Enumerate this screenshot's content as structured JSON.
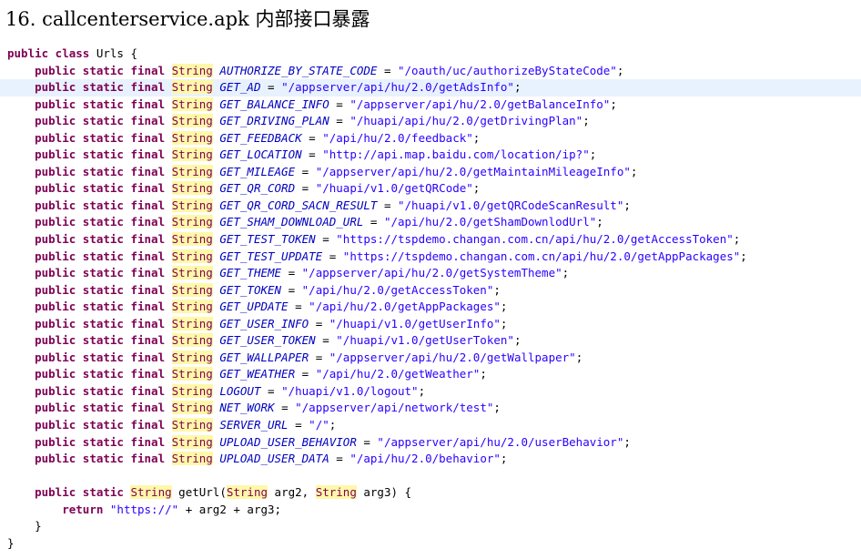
{
  "heading": "16. callcenterservice.apk 内部接口暴露",
  "code": {
    "class_header": {
      "keywords": "public class",
      "name": "Urls",
      "brace": "{"
    },
    "modifiers": "public static final",
    "type_name": "String",
    "fields": [
      {
        "name": "AUTHORIZE_BY_STATE_CODE",
        "value": "\"/oauth/uc/authorizeByStateCode\""
      },
      {
        "name": "GET_AD",
        "value": "\"/appserver/api/hu/2.0/getAdsInfo\""
      },
      {
        "name": "GET_BALANCE_INFO",
        "value": "\"/appserver/api/hu/2.0/getBalanceInfo\""
      },
      {
        "name": "GET_DRIVING_PLAN",
        "value": "\"/huapi/api/hu/2.0/getDrivingPlan\""
      },
      {
        "name": "GET_FEEDBACK",
        "value": "\"/api/hu/2.0/feedback\""
      },
      {
        "name": "GET_LOCATION",
        "value": "\"http://api.map.baidu.com/location/ip?\""
      },
      {
        "name": "GET_MILEAGE",
        "value": "\"/appserver/api/hu/2.0/getMaintainMileageInfo\""
      },
      {
        "name": "GET_QR_CORD",
        "value": "\"/huapi/v1.0/getQRCode\""
      },
      {
        "name": "GET_QR_CORD_SACN_RESULT",
        "value": "\"/huapi/v1.0/getQRCodeScanResult\""
      },
      {
        "name": "GET_SHAM_DOWNLOAD_URL",
        "value": "\"/api/hu/2.0/getShamDownlodUrl\""
      },
      {
        "name": "GET_TEST_TOKEN",
        "value": "\"https://tspdemo.changan.com.cn/api/hu/2.0/getAccessToken\""
      },
      {
        "name": "GET_TEST_UPDATE",
        "value": "\"https://tspdemo.changan.com.cn/api/hu/2.0/getAppPackages\""
      },
      {
        "name": "GET_THEME",
        "value": "\"/appserver/api/hu/2.0/getSystemTheme\""
      },
      {
        "name": "GET_TOKEN",
        "value": "\"/api/hu/2.0/getAccessToken\""
      },
      {
        "name": "GET_UPDATE",
        "value": "\"/api/hu/2.0/getAppPackages\""
      },
      {
        "name": "GET_USER_INFO",
        "value": "\"/huapi/v1.0/getUserInfo\""
      },
      {
        "name": "GET_USER_TOKEN",
        "value": "\"/huapi/v1.0/getUserToken\""
      },
      {
        "name": "GET_WALLPAPER",
        "value": "\"/appserver/api/hu/2.0/getWallpaper\""
      },
      {
        "name": "GET_WEATHER",
        "value": "\"/api/hu/2.0/getWeather\""
      },
      {
        "name": "LOGOUT",
        "value": "\"/huapi/v1.0/logout\""
      },
      {
        "name": "NET_WORK",
        "value": "\"/appserver/api/network/test\""
      },
      {
        "name": "SERVER_URL",
        "value": "\"/\""
      },
      {
        "name": "UPLOAD_USER_BEHAVIOR",
        "value": "\"/appserver/api/hu/2.0/userBehavior\""
      },
      {
        "name": "UPLOAD_USER_DATA",
        "value": "\"/api/hu/2.0/behavior\""
      }
    ],
    "method": {
      "modifiers": "public static",
      "return_type": "String",
      "name": "getUrl(",
      "param1_type": "String",
      "param1_name": " arg2, ",
      "param2_type": "String",
      "param2_name": " arg3) {",
      "return_keyword": "return",
      "return_literal": "\"https://\"",
      "return_rest": " + arg2 + arg3;",
      "close_brace": "}"
    },
    "class_close": "}"
  }
}
